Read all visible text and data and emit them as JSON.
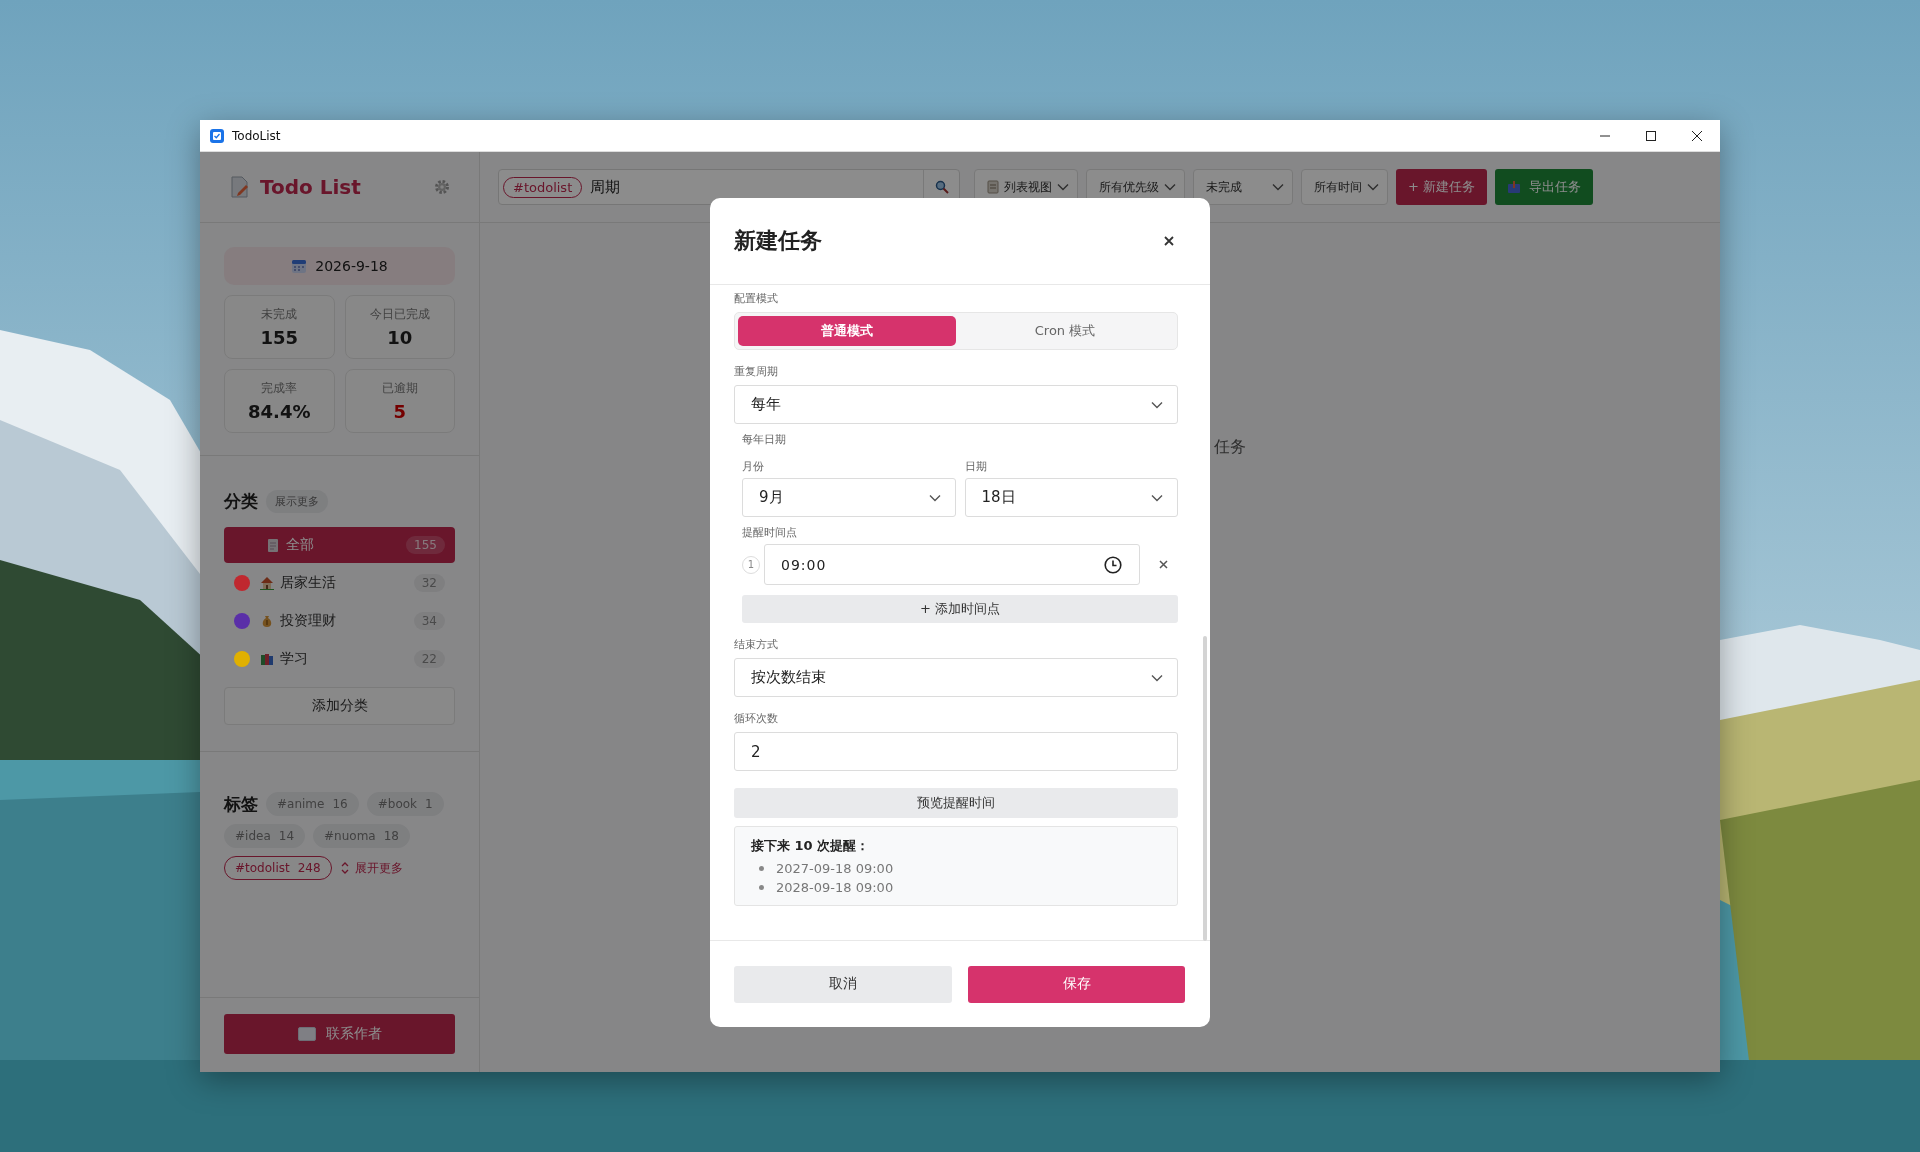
{
  "window": {
    "title": "TodoList"
  },
  "sidebar": {
    "app_title": "Todo List",
    "date": "2026-9-18",
    "stats": [
      {
        "label": "未完成",
        "value": "155",
        "kind": "normal"
      },
      {
        "label": "今日已完成",
        "value": "10",
        "kind": "normal"
      },
      {
        "label": "完成率",
        "value": "84.4%",
        "kind": "normal"
      },
      {
        "label": "已逾期",
        "value": "5",
        "kind": "alert"
      }
    ],
    "categories": {
      "title": "分类",
      "more_button": "展示更多",
      "items": [
        {
          "label": "全部",
          "count": "155",
          "kind": "all",
          "selected": true
        },
        {
          "label": "居家生活",
          "count": "32",
          "kind": "home",
          "color": "#c0282f",
          "selected": false
        },
        {
          "label": "投资理财",
          "count": "34",
          "kind": "money",
          "color": "#5a2fa8",
          "selected": false
        },
        {
          "label": "学习",
          "count": "22",
          "kind": "books",
          "color": "#e0b000",
          "selected": false
        }
      ],
      "add_button": "添加分类"
    },
    "tags": {
      "title": "标签",
      "items": [
        {
          "label": "#anime",
          "count": "16",
          "selected": false
        },
        {
          "label": "#book",
          "count": "1",
          "selected": false
        },
        {
          "label": "#idea",
          "count": "14",
          "selected": false
        },
        {
          "label": "#nuoma",
          "count": "18",
          "selected": false
        },
        {
          "label": "#todolist",
          "count": "248",
          "selected": true
        }
      ],
      "expand_link": "展开更多"
    },
    "contact_button": "联系作者"
  },
  "toolbar": {
    "search": {
      "tag": "#todolist",
      "value": "周期"
    },
    "filters": [
      {
        "label": "列表视图",
        "kind": "view"
      },
      {
        "label": "所有优先级",
        "kind": "plain"
      },
      {
        "label": "未完成",
        "kind": "wide"
      },
      {
        "label": "所有时间",
        "kind": "plain"
      }
    ],
    "new_button": "+ 新建任务",
    "export_button": "导出任务"
  },
  "main": {
    "empty_text": "任务"
  },
  "modal": {
    "title": "新建任务",
    "mode_label": "配置模式",
    "modes": [
      {
        "label": "普通模式",
        "selected": true
      },
      {
        "label": "Cron 模式",
        "selected": false
      }
    ],
    "repeat_label": "重复周期",
    "repeat_value": "每年",
    "yearly_label": "每年日期",
    "month_label": "月份",
    "month_value": "9月",
    "day_label": "日期",
    "day_value": "18日",
    "reminder_label": "提醒时间点",
    "reminders": [
      {
        "index": "1",
        "time": "09:00"
      }
    ],
    "add_time_button": "+ 添加时间点",
    "end_label": "结束方式",
    "end_value": "按次数结束",
    "count_label": "循环次数",
    "count_value": "2",
    "preview_button": "预览提醒时间",
    "preview": {
      "title": "接下来 10 次提醒：",
      "items": [
        "2027-09-18 09:00",
        "2028-09-18 09:00"
      ]
    },
    "cancel_button": "取消",
    "save_button": "保存"
  }
}
